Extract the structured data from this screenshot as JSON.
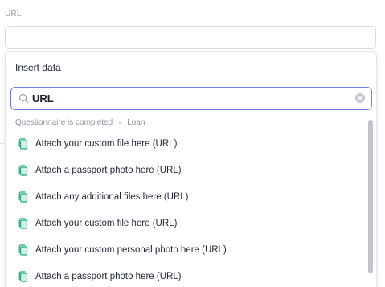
{
  "field": {
    "label": "URL",
    "value": ""
  },
  "dropdown": {
    "title": "Insert data",
    "search": {
      "value": "URL",
      "icon": "search-icon",
      "clear_icon": "close-icon"
    },
    "breadcrumb": [
      "Questionnaire is completed",
      "Loan"
    ],
    "items": [
      {
        "label": "Attach your custom file here (URL)",
        "icon": "file-icon"
      },
      {
        "label": "Attach a passport photo here (URL)",
        "icon": "file-icon"
      },
      {
        "label": "Attach any additional files here (URL)",
        "icon": "file-icon"
      },
      {
        "label": "Attach your custom file here (URL)",
        "icon": "file-icon"
      },
      {
        "label": "Attach your custom personal photo here (URL)",
        "icon": "file-icon"
      },
      {
        "label": "Attach a passport photo here (URL)",
        "icon": "file-icon"
      }
    ]
  },
  "colors": {
    "accent": "#6f7cf0",
    "file_icon": "#1fa77a",
    "text": "#1f2533",
    "muted": "#8b919c"
  }
}
